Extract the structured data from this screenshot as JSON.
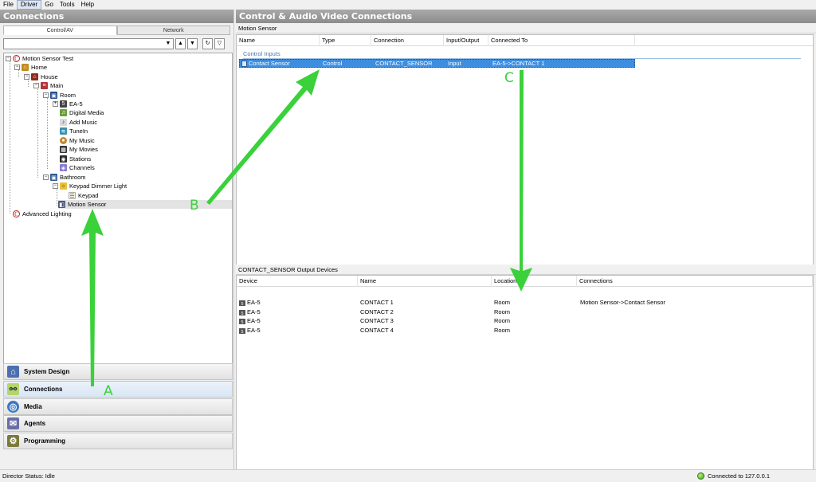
{
  "menu": {
    "items": [
      "File",
      "Driver",
      "Go",
      "Tools",
      "Help"
    ],
    "active": "Driver"
  },
  "left_panel": {
    "title": "Connections",
    "tabs": [
      "Control/AV",
      "Network"
    ],
    "tree": [
      {
        "label": "Motion Sensor Test",
        "icon": "project-icon"
      },
      {
        "label": "Home",
        "icon": "home-icon"
      },
      {
        "label": "House",
        "icon": "house-icon"
      },
      {
        "label": "Main",
        "icon": "floor-icon"
      },
      {
        "label": "Room",
        "icon": "room-icon"
      },
      {
        "label": "EA-5",
        "icon": "controller-icon"
      },
      {
        "label": "Digital Media",
        "icon": "digital-media-icon"
      },
      {
        "label": "Add Music",
        "icon": "add-music-icon"
      },
      {
        "label": "TuneIn",
        "icon": "tunein-icon"
      },
      {
        "label": "My Music",
        "icon": "my-music-icon"
      },
      {
        "label": "My Movies",
        "icon": "my-movies-icon"
      },
      {
        "label": "Stations",
        "icon": "stations-icon"
      },
      {
        "label": "Channels",
        "icon": "channels-icon"
      },
      {
        "label": "Bathroom",
        "icon": "room-icon"
      },
      {
        "label": "Keypad Dimmer Light",
        "icon": "dimmer-icon"
      },
      {
        "label": "Keypad",
        "icon": "keypad-icon"
      },
      {
        "label": "Motion Sensor",
        "icon": "motion-sensor-icon"
      },
      {
        "label": "Advanced Lighting",
        "icon": "project-icon"
      }
    ],
    "nav": [
      {
        "label": "System Design",
        "icon": "system-design-icon"
      },
      {
        "label": "Connections",
        "icon": "connections-icon"
      },
      {
        "label": "Media",
        "icon": "media-icon"
      },
      {
        "label": "Agents",
        "icon": "agents-icon"
      },
      {
        "label": "Programming",
        "icon": "programming-icon"
      }
    ]
  },
  "right_panel": {
    "title": "Control & Audio Video Connections",
    "device_label": "Motion Sensor",
    "columns": [
      "Name",
      "Type",
      "Connection",
      "Input/Output",
      "Connected To"
    ],
    "group_label": "Control Inputs",
    "rows": [
      {
        "name": "Contact Sensor",
        "type": "Control",
        "connection": "CONTACT_SENSOR",
        "io": "Input",
        "connected_to": "EA-5->CONTACT 1"
      }
    ],
    "output_title": "CONTACT_SENSOR Output Devices",
    "output_columns": [
      "Device",
      "Name",
      "Location",
      "Connections"
    ],
    "output_rows": [
      {
        "device": "EA-5",
        "name": "CONTACT 1",
        "location": "Room",
        "connections": "Motion Sensor->Contact Sensor"
      },
      {
        "device": "EA-5",
        "name": "CONTACT 2",
        "location": "Room",
        "connections": ""
      },
      {
        "device": "EA-5",
        "name": "CONTACT 3",
        "location": "Room",
        "connections": ""
      },
      {
        "device": "EA-5",
        "name": "CONTACT 4",
        "location": "Room",
        "connections": ""
      }
    ]
  },
  "status": {
    "left": "Director Status: Idle",
    "right": "Connected to 127.0.0.1"
  },
  "annotations": {
    "labels": [
      "A",
      "B",
      "C"
    ],
    "color": "#3ad13a"
  },
  "colors": {
    "header_gray": "#999999",
    "selection_blue": "#3d8ee0",
    "group_blue": "#4a78b0"
  }
}
